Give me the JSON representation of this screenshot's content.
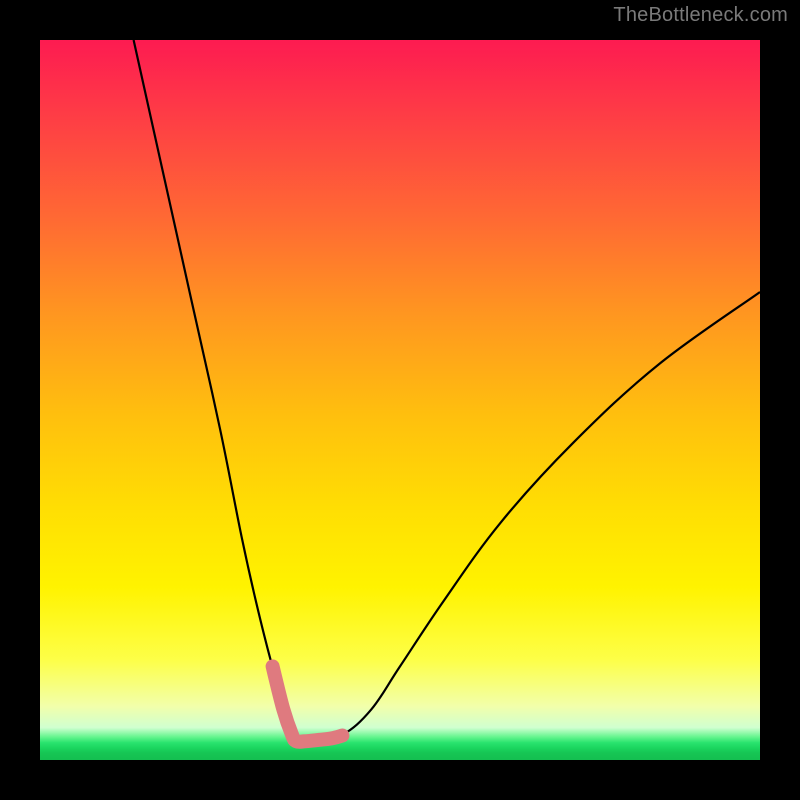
{
  "watermark": "TheBottleneck.com",
  "chart_data": {
    "type": "line",
    "title": "",
    "xlabel": "",
    "ylabel": "",
    "xlim": [
      0,
      100
    ],
    "ylim": [
      0,
      100
    ],
    "grid": false,
    "legend": false,
    "series": [
      {
        "name": "bottleneck-curve",
        "color": "#000000",
        "x": [
          13,
          17,
          21,
          25,
          28,
          30,
          32,
          34,
          35.5,
          36.5,
          38,
          42,
          46,
          50,
          56,
          64,
          74,
          86,
          100
        ],
        "y": [
          100,
          82,
          64,
          46,
          31,
          22,
          14,
          7,
          3.2,
          2.6,
          2.7,
          3.5,
          7,
          13,
          22,
          33,
          44,
          55,
          65
        ]
      },
      {
        "name": "highlight-segment",
        "color": "#df7a7f",
        "x": [
          32.3,
          33.8,
          35.0,
          35.6,
          36.8,
          38.8,
          40.5,
          42.0
        ],
        "y": [
          13.0,
          7.0,
          3.5,
          2.6,
          2.6,
          2.8,
          3.0,
          3.4
        ]
      }
    ],
    "background_gradient": {
      "orientation": "vertical",
      "stops": [
        {
          "pos": 0.0,
          "color": "#fd1b51"
        },
        {
          "pos": 0.25,
          "color": "#ff6a33"
        },
        {
          "pos": 0.52,
          "color": "#ffbf0e"
        },
        {
          "pos": 0.76,
          "color": "#fff300"
        },
        {
          "pos": 0.93,
          "color": "#f2ffaa"
        },
        {
          "pos": 0.97,
          "color": "#64f58e"
        },
        {
          "pos": 1.0,
          "color": "#14bf50"
        }
      ]
    }
  }
}
